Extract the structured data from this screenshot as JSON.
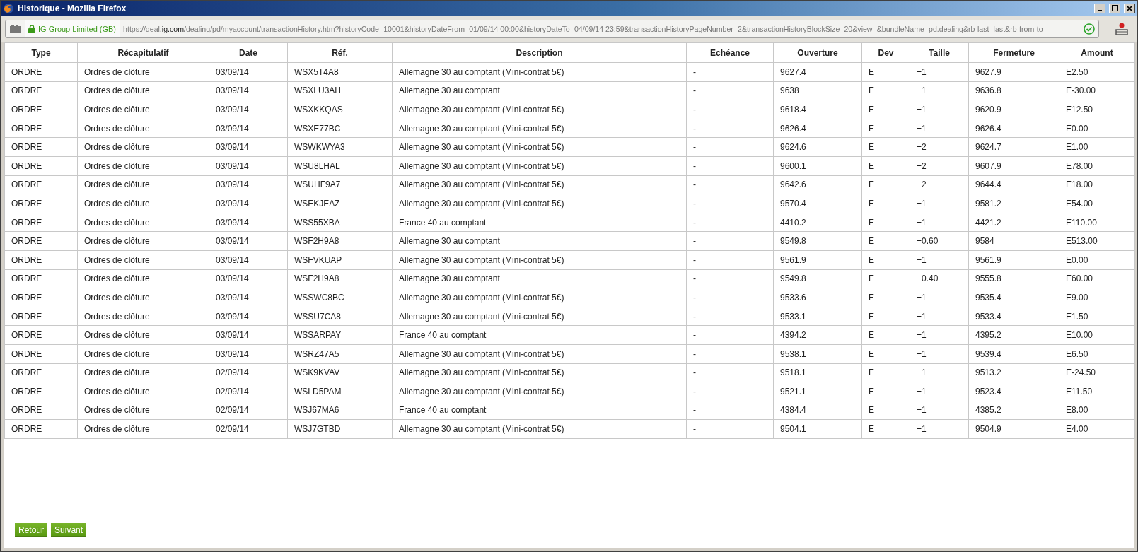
{
  "window": {
    "title": "Historique - Mozilla Firefox"
  },
  "address_bar": {
    "identity": "IG Group Limited (GB)",
    "url": "https://deal.**ig.com**/dealing/pd/myaccount/transactionHistory.htm?historyCode=10001&historyDateFrom=01/09/14 00:00&historyDateTo=04/09/14 23:59&transactionHistoryPageNumber=2&transactionHistoryBlockSize=20&view=&bundleName=pd.dealing&rb-last=last&rb-from-to="
  },
  "table": {
    "columns": [
      "Type",
      "Récapitulatif",
      "Date",
      "Réf.",
      "Description",
      "Echéance",
      "Ouverture",
      "Dev",
      "Taille",
      "Fermeture",
      "Amount"
    ],
    "rows": [
      [
        "ORDRE",
        "Ordres de clôture",
        "03/09/14",
        "WSX5T4A8",
        "Allemagne 30 au comptant (Mini-contrat 5€)",
        "-",
        "9627.4",
        "E",
        "+1",
        "9627.9",
        "E2.50"
      ],
      [
        "ORDRE",
        "Ordres de clôture",
        "03/09/14",
        "WSXLU3AH",
        "Allemagne 30 au comptant",
        "-",
        "9638",
        "E",
        "+1",
        "9636.8",
        "E-30.00"
      ],
      [
        "ORDRE",
        "Ordres de clôture",
        "03/09/14",
        "WSXKKQAS",
        "Allemagne 30 au comptant (Mini-contrat 5€)",
        "-",
        "9618.4",
        "E",
        "+1",
        "9620.9",
        "E12.50"
      ],
      [
        "ORDRE",
        "Ordres de clôture",
        "03/09/14",
        "WSXE77BC",
        "Allemagne 30 au comptant (Mini-contrat 5€)",
        "-",
        "9626.4",
        "E",
        "+1",
        "9626.4",
        "E0.00"
      ],
      [
        "ORDRE",
        "Ordres de clôture",
        "03/09/14",
        "WSWKWYA3",
        "Allemagne 30 au comptant (Mini-contrat 5€)",
        "-",
        "9624.6",
        "E",
        "+2",
        "9624.7",
        "E1.00"
      ],
      [
        "ORDRE",
        "Ordres de clôture",
        "03/09/14",
        "WSU8LHAL",
        "Allemagne 30 au comptant (Mini-contrat 5€)",
        "-",
        "9600.1",
        "E",
        "+2",
        "9607.9",
        "E78.00"
      ],
      [
        "ORDRE",
        "Ordres de clôture",
        "03/09/14",
        "WSUHF9A7",
        "Allemagne 30 au comptant (Mini-contrat 5€)",
        "-",
        "9642.6",
        "E",
        "+2",
        "9644.4",
        "E18.00"
      ],
      [
        "ORDRE",
        "Ordres de clôture",
        "03/09/14",
        "WSEKJEAZ",
        "Allemagne 30 au comptant (Mini-contrat 5€)",
        "-",
        "9570.4",
        "E",
        "+1",
        "9581.2",
        "E54.00"
      ],
      [
        "ORDRE",
        "Ordres de clôture",
        "03/09/14",
        "WSS55XBA",
        "France 40 au comptant",
        "-",
        "4410.2",
        "E",
        "+1",
        "4421.2",
        "E110.00"
      ],
      [
        "ORDRE",
        "Ordres de clôture",
        "03/09/14",
        "WSF2H9A8",
        "Allemagne 30 au comptant",
        "-",
        "9549.8",
        "E",
        "+0.60",
        "9584",
        "E513.00"
      ],
      [
        "ORDRE",
        "Ordres de clôture",
        "03/09/14",
        "WSFVKUAP",
        "Allemagne 30 au comptant (Mini-contrat 5€)",
        "-",
        "9561.9",
        "E",
        "+1",
        "9561.9",
        "E0.00"
      ],
      [
        "ORDRE",
        "Ordres de clôture",
        "03/09/14",
        "WSF2H9A8",
        "Allemagne 30 au comptant",
        "-",
        "9549.8",
        "E",
        "+0.40",
        "9555.8",
        "E60.00"
      ],
      [
        "ORDRE",
        "Ordres de clôture",
        "03/09/14",
        "WSSWC8BC",
        "Allemagne 30 au comptant (Mini-contrat 5€)",
        "-",
        "9533.6",
        "E",
        "+1",
        "9535.4",
        "E9.00"
      ],
      [
        "ORDRE",
        "Ordres de clôture",
        "03/09/14",
        "WSSU7CA8",
        "Allemagne 30 au comptant (Mini-contrat 5€)",
        "-",
        "9533.1",
        "E",
        "+1",
        "9533.4",
        "E1.50"
      ],
      [
        "ORDRE",
        "Ordres de clôture",
        "03/09/14",
        "WSSARPAY",
        "France 40 au comptant",
        "-",
        "4394.2",
        "E",
        "+1",
        "4395.2",
        "E10.00"
      ],
      [
        "ORDRE",
        "Ordres de clôture",
        "03/09/14",
        "WSRZ47A5",
        "Allemagne 30 au comptant (Mini-contrat 5€)",
        "-",
        "9538.1",
        "E",
        "+1",
        "9539.4",
        "E6.50"
      ],
      [
        "ORDRE",
        "Ordres de clôture",
        "02/09/14",
        "WSK9KVAV",
        "Allemagne 30 au comptant (Mini-contrat 5€)",
        "-",
        "9518.1",
        "E",
        "+1",
        "9513.2",
        "E-24.50"
      ],
      [
        "ORDRE",
        "Ordres de clôture",
        "02/09/14",
        "WSLD5PAM",
        "Allemagne 30 au comptant (Mini-contrat 5€)",
        "-",
        "9521.1",
        "E",
        "+1",
        "9523.4",
        "E11.50"
      ],
      [
        "ORDRE",
        "Ordres de clôture",
        "02/09/14",
        "WSJ67MA6",
        "France 40 au comptant",
        "-",
        "4384.4",
        "E",
        "+1",
        "4385.2",
        "E8.00"
      ],
      [
        "ORDRE",
        "Ordres de clôture",
        "02/09/14",
        "WSJ7GTBD",
        "Allemagne 30 au comptant (Mini-contrat 5€)",
        "-",
        "9504.1",
        "E",
        "+1",
        "9504.9",
        "E4.00"
      ]
    ]
  },
  "buttons": [
    "Retour",
    "Suivant"
  ]
}
